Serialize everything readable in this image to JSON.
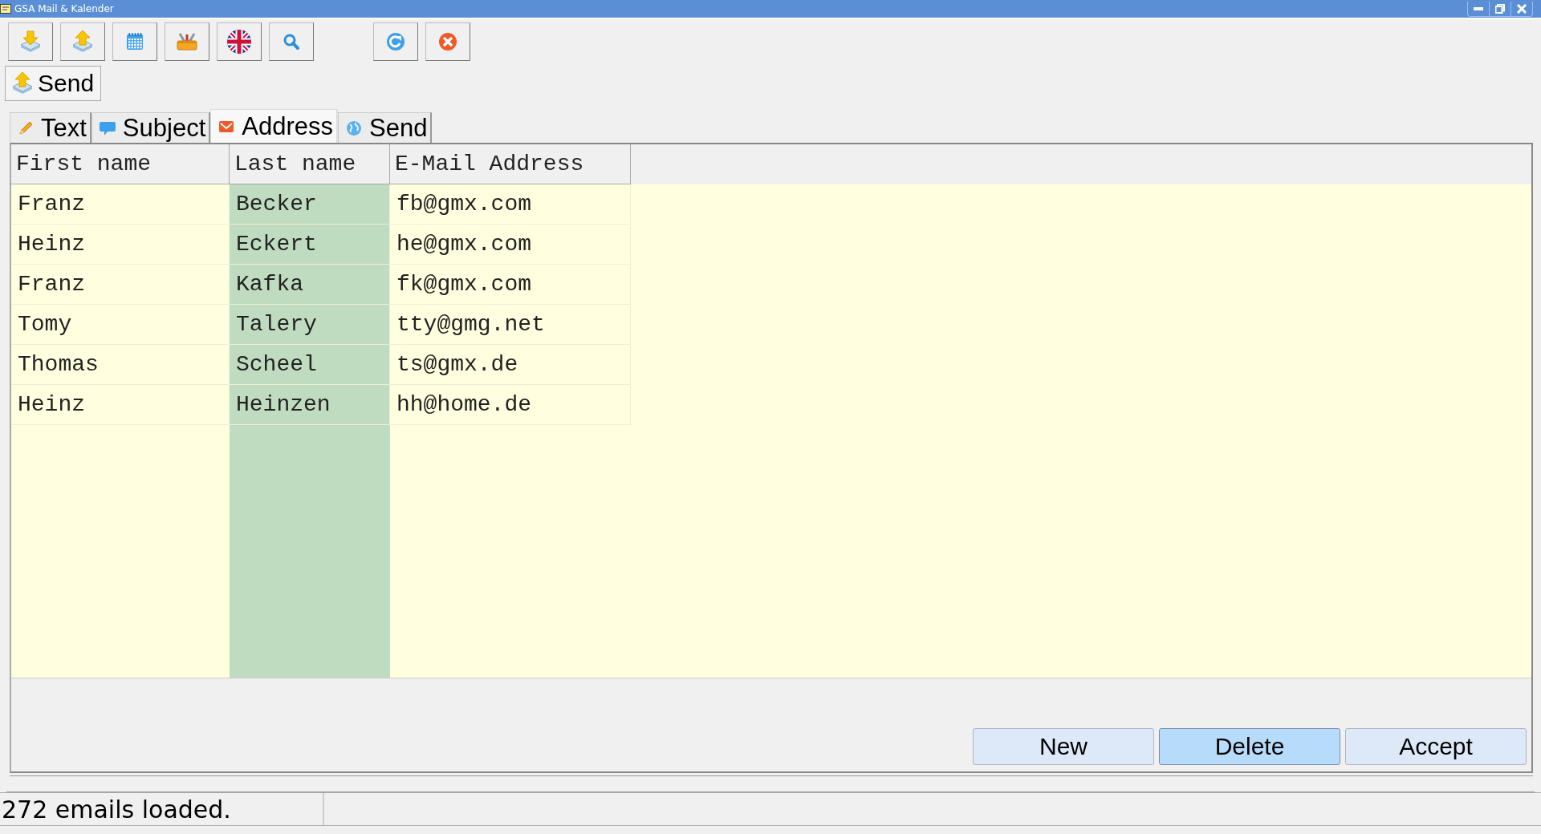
{
  "window": {
    "title": "GSA Mail & Kalender"
  },
  "send_button": {
    "label": "Send"
  },
  "tabs": [
    {
      "label": "Text",
      "selected": false
    },
    {
      "label": "Subject",
      "selected": false
    },
    {
      "label": "Address",
      "selected": true
    },
    {
      "label": "Send",
      "selected": false
    }
  ],
  "table": {
    "columns": [
      "First name",
      "Last name",
      "E-Mail Address"
    ],
    "rows": [
      [
        "Franz",
        "Becker",
        "fb@gmx.com"
      ],
      [
        "Heinz",
        "Eckert",
        "he@gmx.com"
      ],
      [
        "Franz",
        "Kafka",
        "fk@gmx.com"
      ],
      [
        "Tomy",
        "Talery",
        "tty@gmg.net"
      ],
      [
        "Thomas",
        "Scheel",
        "ts@gmx.de"
      ],
      [
        "Heinz",
        "Heinzen",
        "hh@home.de"
      ]
    ]
  },
  "buttons": [
    {
      "label": "New",
      "highlighted": false
    },
    {
      "label": "Delete",
      "highlighted": true
    },
    {
      "label": "Accept",
      "highlighted": false
    }
  ],
  "status_bar": {
    "message": "272 emails loaded."
  }
}
